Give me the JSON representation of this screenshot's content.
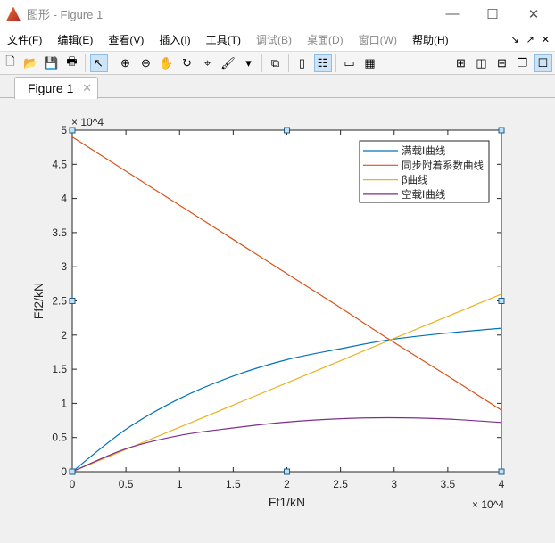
{
  "window": {
    "title": "图形 - Figure 1",
    "minimize": "—",
    "maximize": "☐",
    "close": "✕"
  },
  "menus": [
    {
      "label": "文件(F)",
      "enabled": true
    },
    {
      "label": "编辑(E)",
      "enabled": true
    },
    {
      "label": "查看(V)",
      "enabled": true
    },
    {
      "label": "插入(I)",
      "enabled": true
    },
    {
      "label": "工具(T)",
      "enabled": true
    },
    {
      "label": "调试(B)",
      "enabled": false
    },
    {
      "label": "桌面(D)",
      "enabled": false
    },
    {
      "label": "窗口(W)",
      "enabled": false
    },
    {
      "label": "帮助(H)",
      "enabled": true
    }
  ],
  "menu_right": {
    "dock": "↘",
    "undock": "↗",
    "close": "✕"
  },
  "toolbar": [
    {
      "icon": "new-figure-icon",
      "glyph": "🗋"
    },
    {
      "icon": "open-icon",
      "glyph": "📂"
    },
    {
      "icon": "save-icon",
      "glyph": "💾"
    },
    {
      "icon": "print-icon",
      "glyph": "🖶"
    },
    {
      "sep": true
    },
    {
      "icon": "edit-plot-arrow-icon",
      "glyph": "↖",
      "on": true
    },
    {
      "sep": true
    },
    {
      "icon": "zoom-in-icon",
      "glyph": "⊕"
    },
    {
      "icon": "zoom-out-icon",
      "glyph": "⊖"
    },
    {
      "icon": "pan-hand-icon",
      "glyph": "✋"
    },
    {
      "icon": "rotate-3d-icon",
      "glyph": "↻"
    },
    {
      "icon": "data-cursor-icon",
      "glyph": "⌖"
    },
    {
      "icon": "brush-icon",
      "glyph": "🖌"
    },
    {
      "icon": "dropdown-arrow-icon",
      "glyph": "▾"
    },
    {
      "sep": true
    },
    {
      "icon": "link-plot-icon",
      "glyph": "⧉"
    },
    {
      "sep": true
    },
    {
      "icon": "colorbar-icon",
      "glyph": "▯"
    },
    {
      "icon": "legend-icon",
      "glyph": "☷",
      "on": true
    },
    {
      "sep": true
    },
    {
      "icon": "hide-plot-tools-icon",
      "glyph": "▭"
    },
    {
      "icon": "show-plot-tools-icon",
      "glyph": "▦"
    }
  ],
  "layout_buttons": [
    {
      "icon": "tile-grid-icon",
      "glyph": "⊞"
    },
    {
      "icon": "tile-columns-icon",
      "glyph": "◫"
    },
    {
      "icon": "tile-rows-icon",
      "glyph": "⊟"
    },
    {
      "icon": "float-icon",
      "glyph": "❐"
    },
    {
      "icon": "maximize-icon",
      "glyph": "☐",
      "on": true
    }
  ],
  "tab": {
    "label": "Figure 1",
    "close": "✕"
  },
  "chart_data": {
    "type": "line",
    "xlabel": "Ff1/kN",
    "ylabel": "Ff2/kN",
    "xlim": [
      0,
      40000
    ],
    "ylim": [
      0,
      50000
    ],
    "x_exponent": "× 10^4",
    "y_exponent": "× 10^4",
    "xticks": [
      "0",
      "0.5",
      "1",
      "1.5",
      "2",
      "2.5",
      "3",
      "3.5",
      "4"
    ],
    "yticks": [
      "0",
      "0.5",
      "1",
      "1.5",
      "2",
      "2.5",
      "3",
      "3.5",
      "4",
      "4.5",
      "5"
    ],
    "legend_position": "top-right",
    "x": [
      0,
      5000,
      10000,
      15000,
      20000,
      25000,
      29500,
      35000,
      40000
    ],
    "series": [
      {
        "name": "满载I曲线",
        "color": "#0072bd",
        "values": [
          0,
          6200,
          10700,
          14000,
          16400,
          18000,
          19300,
          20300,
          21000
        ]
      },
      {
        "name": "同步附着系数曲线",
        "color": "#d95319",
        "values": [
          49000,
          44000,
          39000,
          34000,
          29000,
          24000,
          19400,
          14000,
          9000
        ]
      },
      {
        "name": "β曲线",
        "color": "#edb120",
        "values": [
          0,
          3250,
          6500,
          9750,
          13000,
          16250,
          19200,
          22750,
          26000
        ]
      },
      {
        "name": "空载I曲线",
        "color": "#7e2f8e",
        "values": [
          0,
          3350,
          5300,
          6400,
          7260,
          7750,
          7900,
          7700,
          7200
        ]
      }
    ]
  }
}
